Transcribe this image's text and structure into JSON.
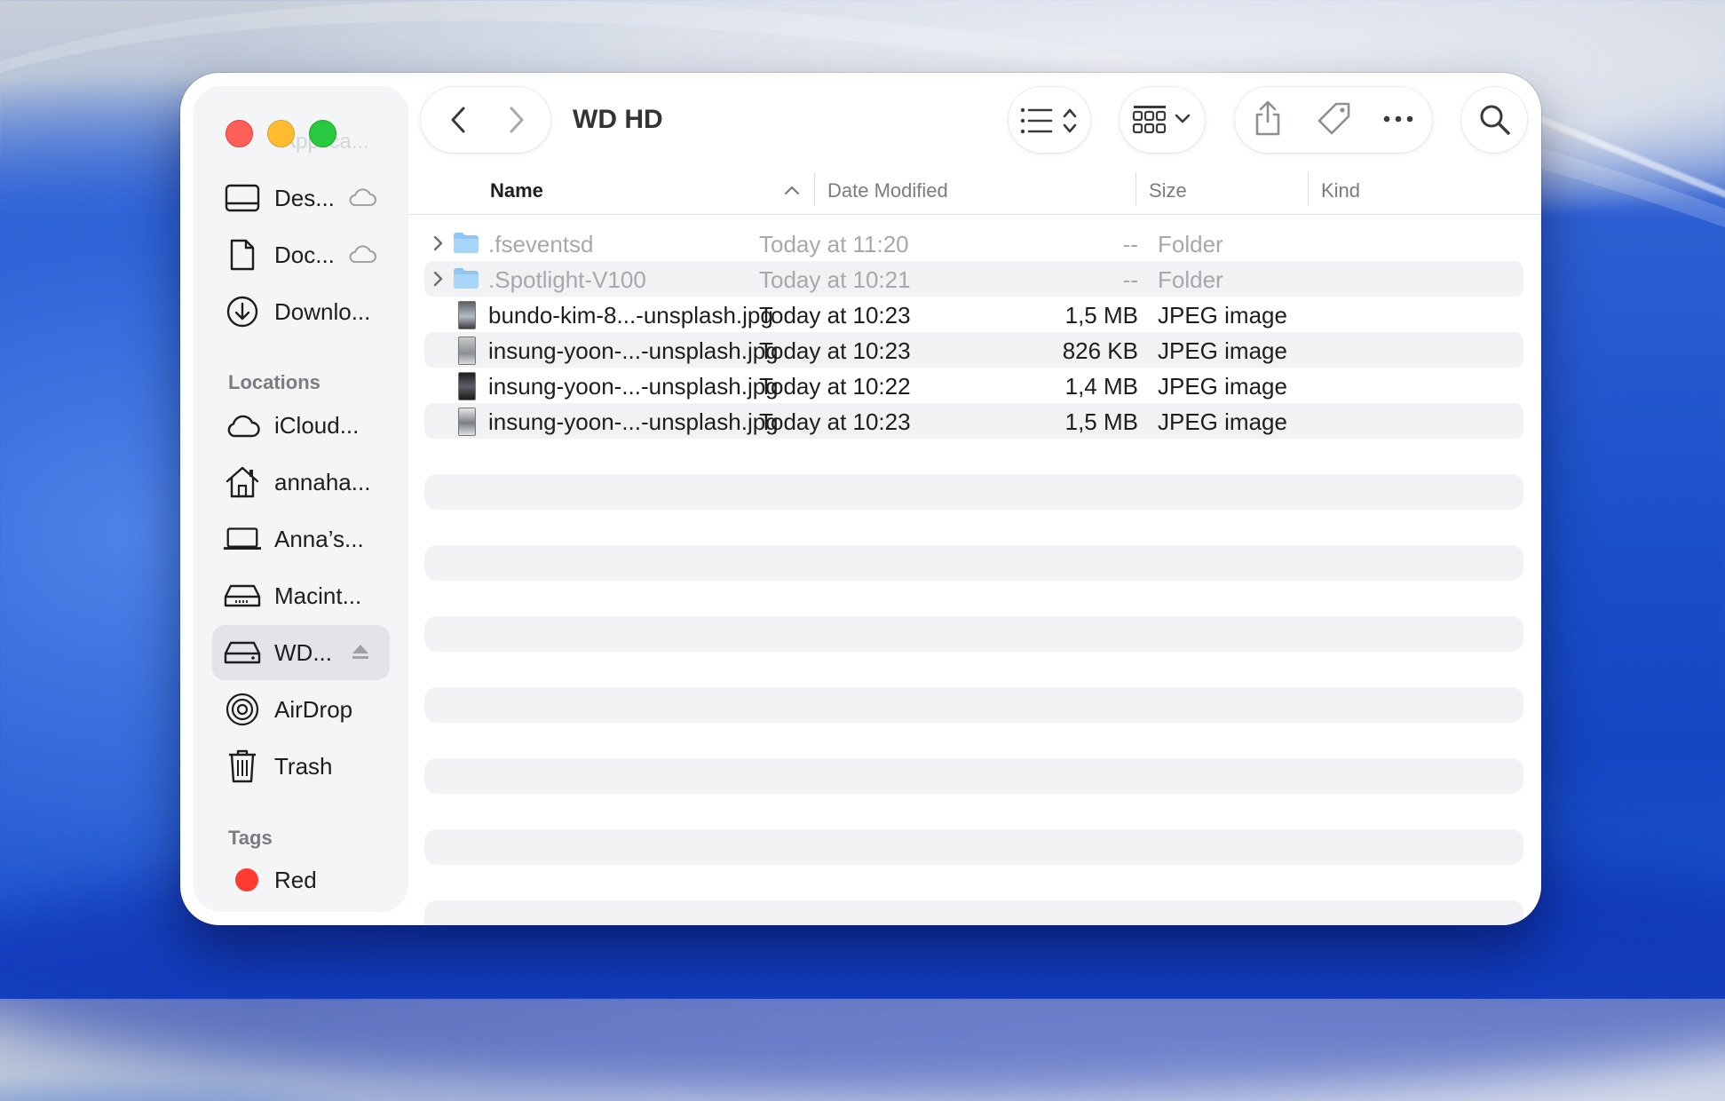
{
  "window": {
    "title": "WD HD",
    "ghost_label": "Applica..."
  },
  "sidebar": {
    "favorites": [
      {
        "label": "Des...",
        "icon": "desktop-icon",
        "cloud": true
      },
      {
        "label": "Doc...",
        "icon": "document-icon",
        "cloud": true
      },
      {
        "label": "Downlo...",
        "icon": "download-icon",
        "cloud": false
      }
    ],
    "locations_header": "Locations",
    "locations": [
      {
        "label": "iCloud...",
        "icon": "icloud-icon"
      },
      {
        "label": "annaha...",
        "icon": "home-icon"
      },
      {
        "label": "Anna’s...",
        "icon": "laptop-icon"
      },
      {
        "label": "Macint...",
        "icon": "internal-disk-icon"
      },
      {
        "label": "WD...",
        "icon": "external-disk-icon",
        "selected": true,
        "eject": true
      },
      {
        "label": "AirDrop",
        "icon": "airdrop-icon"
      },
      {
        "label": "Trash",
        "icon": "trash-icon"
      }
    ],
    "tags_header": "Tags",
    "tags": [
      {
        "label": "Red",
        "color": "#ff3b30"
      }
    ]
  },
  "toolbar": {
    "back": "chevron-left-icon",
    "forward": "chevron-right-icon",
    "view_list": "list-view-icon",
    "group": "grid-group-icon",
    "share": "share-icon",
    "tag": "tag-icon",
    "more": "more-icon",
    "search": "search-icon"
  },
  "columns": {
    "name": "Name",
    "date": "Date Modified",
    "size": "Size",
    "kind": "Kind"
  },
  "files": [
    {
      "name": ".fseventsd",
      "date": "Today at 11:20",
      "size": "--",
      "kind": "Folder",
      "type": "folder",
      "hidden": true
    },
    {
      "name": ".Spotlight-V100",
      "date": "Today at 10:21",
      "size": "--",
      "kind": "Folder",
      "type": "folder",
      "hidden": true
    },
    {
      "name": "bundo-kim-8...-unsplash.jpg",
      "date": "Today at 10:23",
      "size": "1,5 MB",
      "kind": "JPEG image",
      "type": "image"
    },
    {
      "name": "insung-yoon-...-unsplash.jpg",
      "date": "Today at 10:23",
      "size": "826 KB",
      "kind": "JPEG image",
      "type": "image"
    },
    {
      "name": "insung-yoon-...-unsplash.jpg",
      "date": "Today at 10:22",
      "size": "1,4 MB",
      "kind": "JPEG image",
      "type": "image"
    },
    {
      "name": "insung-yoon-...-unsplash.jpg",
      "date": "Today at 10:23",
      "size": "1,5 MB",
      "kind": "JPEG image",
      "type": "image"
    }
  ]
}
